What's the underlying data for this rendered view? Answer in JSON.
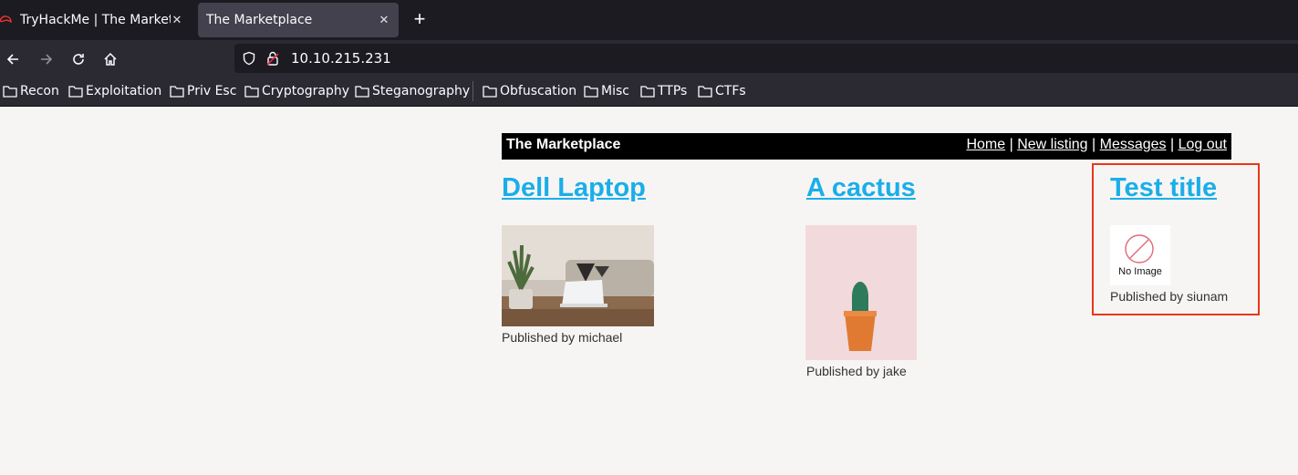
{
  "browser": {
    "tabs": [
      {
        "title": "TryHackMe | The Marketp"
      },
      {
        "title": "The Marketplace"
      }
    ],
    "url": "10.10.215.231",
    "bookmarks": [
      "Recon",
      "Exploitation",
      "Priv Esc",
      "Cryptography",
      "Steganography",
      "Obfuscation",
      "Misc",
      "TTPs",
      "CTFs"
    ]
  },
  "site": {
    "title": "The Marketplace",
    "nav": [
      "Home",
      "New listing",
      "Messages",
      "Log out"
    ],
    "separator": "|"
  },
  "listings": [
    {
      "title": "Dell Laptop",
      "published": "Published by michael"
    },
    {
      "title": "A cactus",
      "published": "Published by jake"
    },
    {
      "title": "Test title",
      "published": "Published by siunam",
      "image_placeholder": "No Image"
    }
  ],
  "colors": {
    "link": "#1aaeea",
    "highlight": "#e8371b"
  }
}
